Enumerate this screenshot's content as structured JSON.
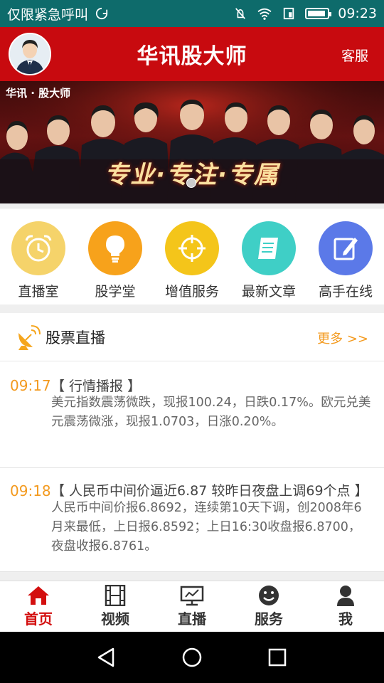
{
  "status_bar": {
    "carrier": "仅限紧急呼叫",
    "time": "09:23"
  },
  "header": {
    "title": "华讯股大师",
    "service_label": "客服"
  },
  "banner": {
    "brand_text": "华讯 · 股大师",
    "slogan": "专业·专注·专属"
  },
  "quick_menu": [
    {
      "label": "直播室",
      "icon": "alarm-clock-icon",
      "color": "#f5d36a"
    },
    {
      "label": "股学堂",
      "icon": "lightbulb-icon",
      "color": "#f7a21b"
    },
    {
      "label": "增值服务",
      "icon": "target-icon",
      "color": "#f4c51a"
    },
    {
      "label": "最新文章",
      "icon": "document-icon",
      "color": "#3fcfc6"
    },
    {
      "label": "高手在线",
      "icon": "pencil-edit-icon",
      "color": "#5b79e8"
    }
  ],
  "stock_live": {
    "title": "股票直播",
    "more_label": "更多 >>",
    "items": [
      {
        "time": "09:17",
        "headline": "【 行情播报 】",
        "body": "美元指数震荡微跌，现报100.24，日跌0.17%。欧元兑美元震荡微涨，现报1.0703，日涨0.20%。"
      },
      {
        "time": "09:18",
        "headline": "【 人民币中间价逼近6.87 较昨日夜盘上调69个点 】",
        "body": "人民币中间价报6.8692，连续第10天下调，创2008年6月来最低，上日报6.8592；上日16:30收盘报6.8700，夜盘收报6.8761。"
      }
    ]
  },
  "tab_bar": [
    {
      "label": "首页",
      "icon": "home-icon",
      "active": true
    },
    {
      "label": "视频",
      "icon": "film-icon",
      "active": false
    },
    {
      "label": "直播",
      "icon": "monitor-icon",
      "active": false
    },
    {
      "label": "服务",
      "icon": "smiley-icon",
      "active": false
    },
    {
      "label": "我",
      "icon": "person-icon",
      "active": false
    }
  ],
  "colors": {
    "brand_red": "#c80a0f",
    "accent_orange": "#f39a1f",
    "status_teal": "#0e6b6b"
  }
}
